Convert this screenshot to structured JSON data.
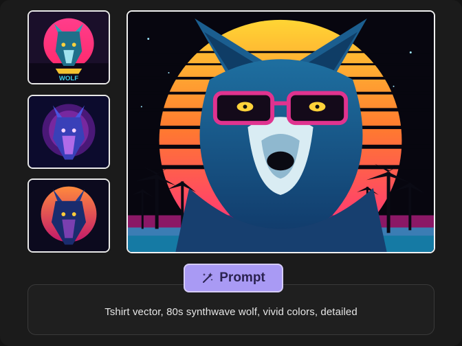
{
  "thumbnails": [
    {
      "name": "thumbnail-wolf-1",
      "caption": "WOLF"
    },
    {
      "name": "thumbnail-wolf-2"
    },
    {
      "name": "thumbnail-wolf-3"
    }
  ],
  "prompt": {
    "badge_label": "Prompt",
    "badge_icon": "magic-wand-icon",
    "text": "Tshirt vector, 80s synthwave wolf, vivid colors, detailed"
  },
  "colors": {
    "accent": "#a99af4",
    "accent_text": "#2b2350",
    "background": "#1b1b1b"
  }
}
